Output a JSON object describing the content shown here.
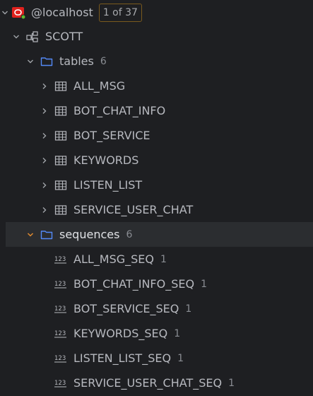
{
  "connection": {
    "name": "@localhost",
    "badge": "1 of 37",
    "icon": "oracle-db-icon"
  },
  "schema": {
    "name": "SCOTT",
    "icon": "schema-icon"
  },
  "tables": {
    "label": "tables",
    "count": "6",
    "icon": "folder-icon",
    "items": [
      {
        "name": "ALL_MSG"
      },
      {
        "name": "BOT_CHAT_INFO"
      },
      {
        "name": "BOT_SERVICE"
      },
      {
        "name": "KEYWORDS"
      },
      {
        "name": "LISTEN_LIST"
      },
      {
        "name": "SERVICE_USER_CHAT"
      }
    ]
  },
  "sequences": {
    "label": "sequences",
    "count": "6",
    "icon": "folder-icon",
    "items": [
      {
        "name": "ALL_MSG_SEQ",
        "count": "1"
      },
      {
        "name": "BOT_CHAT_INFO_SEQ",
        "count": "1"
      },
      {
        "name": "BOT_SERVICE_SEQ",
        "count": "1"
      },
      {
        "name": "KEYWORDS_SEQ",
        "count": "1"
      },
      {
        "name": "LISTEN_LIST_SEQ",
        "count": "1"
      },
      {
        "name": "SERVICE_USER_CHAT_SEQ",
        "count": "1"
      }
    ]
  },
  "colors": {
    "background": "#1e1f22",
    "selected_row": "#2b2d30",
    "folder": "#548af7",
    "expanded_arrow_selected": "#e08a2e",
    "oracle_red": "#e0211d",
    "status_green": "#5fb832"
  }
}
